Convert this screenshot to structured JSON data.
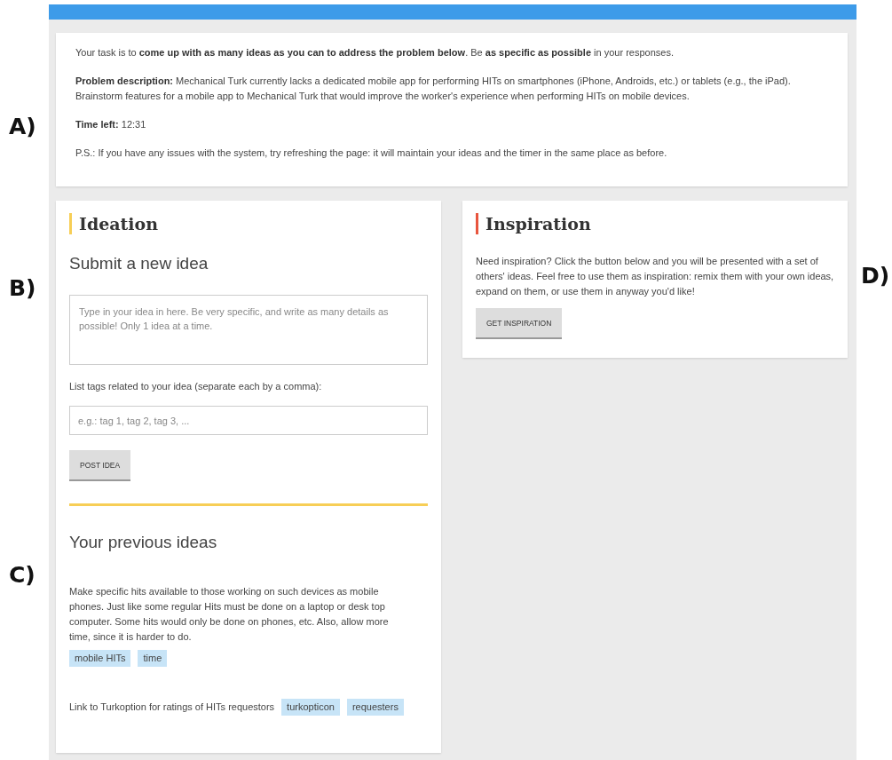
{
  "annotations": [
    {
      "label": "A)"
    },
    {
      "label": "B)"
    },
    {
      "label": "C)"
    },
    {
      "label": "D)"
    }
  ],
  "task": {
    "intro": "Your task is to **come up with as many ideas as you can to address the problem below**. Be **as specific as possible** in your responses.",
    "problem": "**Problem description:** Mechanical Turk currently lacks a dedicated mobile app for performing HITs on smartphones (iPhone, Androids, etc.) or tablets (e.g., the iPad). Brainstorm features for a mobile app to Mechanical Turk that would improve the worker's experience when performing HITs on mobile devices.",
    "time_label": "Time left:",
    "time": "12:31",
    "note": "P.S.: If you have any issues with the system, try refreshing the page: it will maintain your ideas and the timer in the same place as before."
  },
  "ideation": {
    "title": "Ideation",
    "subtitle": "Submit a new idea",
    "idea_placeholder": "Type in your idea in here. Be very specific, and write as many details as possible! Only 1 idea at a time.",
    "tags_label": "List tags related to your idea (separate each by a comma):",
    "tags_placeholder": "e.g.: tag 1, tag 2, tag 3, ...",
    "button": "POST IDEA"
  },
  "previous": {
    "title": "Your previous ideas",
    "ideas": [
      {
        "text": "Make specific hits available to those working on such devices as mobile phones. Just like some regular Hits must be done on a laptop or desk top computer. Some hits would only be done on phones, etc. Also, allow more time, since it is harder to do.",
        "tags": [
          "mobile HITs",
          "time"
        ]
      },
      {
        "text": "Link to Turkoption for ratings of HITs requestors",
        "tags": [
          "turkopticon",
          "requesters"
        ]
      }
    ]
  },
  "inspiration": {
    "title": "Inspiration",
    "text": "Need inspiration? Click the button below and you will be presented with a set of others' ideas. Feel free to use them as inspiration: remix them with your own ideas, expand on them, or use them in anyway you'd like!",
    "button": "GET INSPIRATION"
  }
}
